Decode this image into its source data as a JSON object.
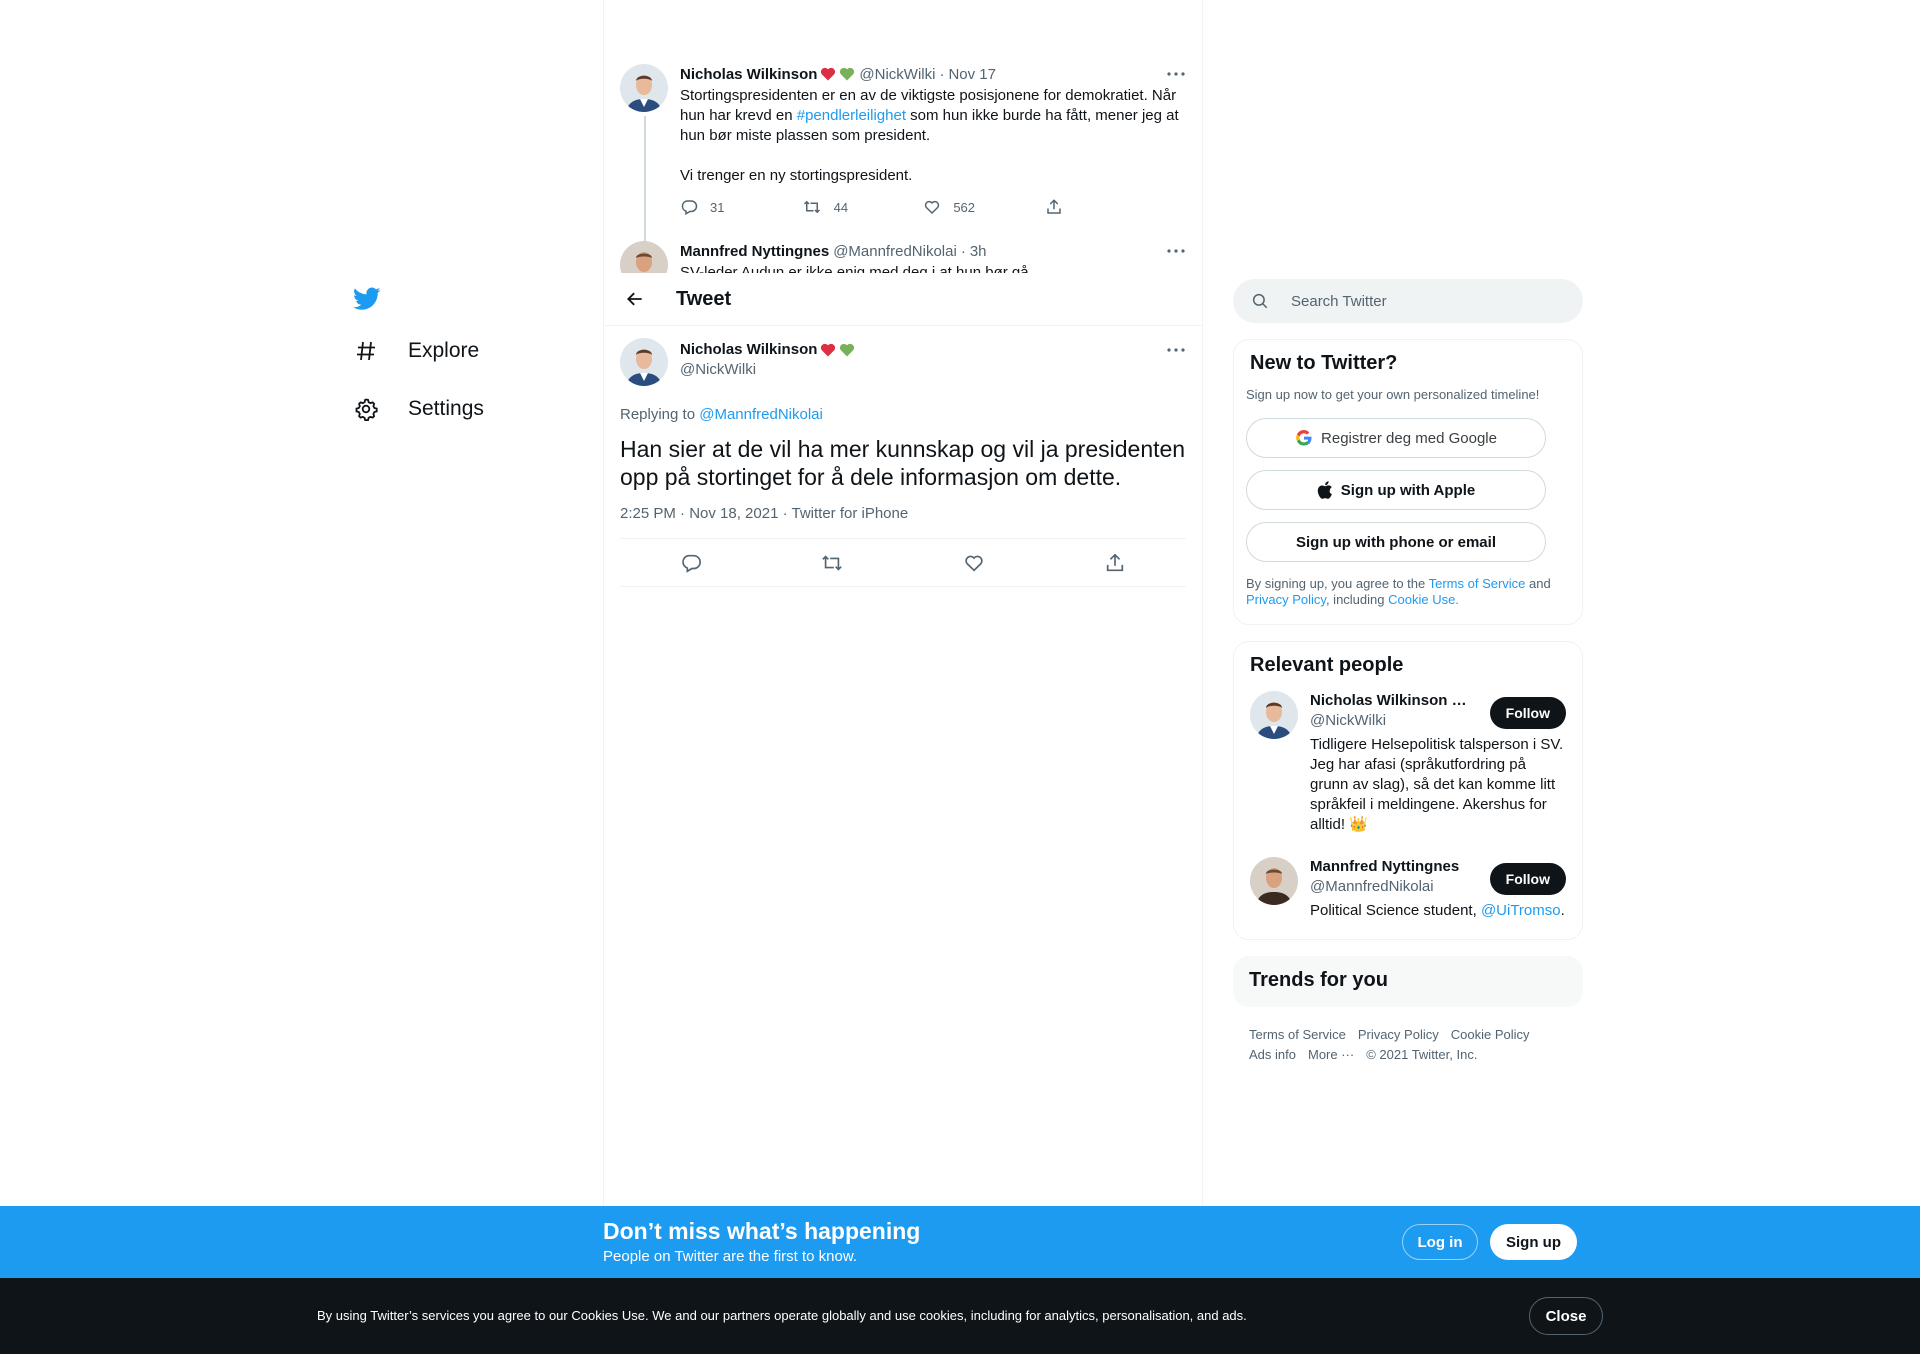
{
  "nav": {
    "items": [
      {
        "label": "Explore",
        "icon": "hashtag-icon"
      },
      {
        "label": "Settings",
        "icon": "gear-icon"
      }
    ]
  },
  "conversation": {
    "tweets": [
      {
        "name": "Nicholas Wilkinson",
        "emojis": [
          "red-heart",
          "green-heart"
        ],
        "handle": "@NickWilki",
        "sep": "·",
        "time": "Nov 17",
        "text_1": "Stortingspresidenten er en av de viktigste posisjonene for demokratiet. Når hun har krevd en ",
        "hashtag": "#pendlerleilighet",
        "text_2": " som hun ikke burde ha fått, mener jeg at hun bør miste plassen som president.",
        "text_3": "Vi trenger en ny stortingspresident.",
        "replies": "31",
        "retweets": "44",
        "likes": "562"
      },
      {
        "name": "Mannfred Nyttingnes",
        "handle": "@MannfredNikolai",
        "sep": "·",
        "time": "3h",
        "text": "SV-leder Audun er ikke enig med deg i at hun bør gå."
      }
    ]
  },
  "header": {
    "title": "Tweet"
  },
  "focal": {
    "name": "Nicholas Wilkinson",
    "handle": "@NickWilki",
    "replying_prefix": "Replying to ",
    "replying_to": "@MannfredNikolai",
    "text": "Han sier at de vil ha mer kunnskap og vil ja presidenten opp på stortinget for å dele informasjon om dette.",
    "meta": "2:25 PM · Nov 18, 2021 · Twitter for iPhone"
  },
  "search": {
    "placeholder": "Search Twitter"
  },
  "new_to_twitter": {
    "title": "New to Twitter?",
    "subtitle": "Sign up now to get your own personalized timeline!",
    "google": "Registrer deg med Google",
    "apple": "Sign up with Apple",
    "phone": "Sign up with phone or email",
    "terms_1": "By signing up, you agree to the ",
    "terms_link": "Terms of Service",
    "terms_2": " and ",
    "privacy_link": "Privacy Policy",
    "terms_3": ", including ",
    "cookie_link": "Cookie Use."
  },
  "relevant": {
    "title": "Relevant people",
    "people": [
      {
        "name": "Nicholas Wilkinson ❤️💚",
        "handle": "@NickWilki",
        "bio": "Tidligere Helsepolitisk talsperson i SV. Jeg har afasi (språkutfordring på grunn av slag), så det kan komme litt språkfeil i meldingene. Akershus for alltid! 👑",
        "follow": "Follow"
      },
      {
        "name": "Mannfred Nyttingnes",
        "handle": "@MannfredNikolai",
        "bio_1": "Political Science student, ",
        "bio_link": "@UiTromso",
        "bio_2": ".",
        "follow": "Follow"
      }
    ]
  },
  "trends": {
    "title": "Trends for you"
  },
  "footer": {
    "links": [
      "Terms of Service",
      "Privacy Policy",
      "Cookie Policy",
      "Ads info",
      "More ···",
      "© 2021 Twitter, Inc."
    ]
  },
  "banner": {
    "title": "Don’t miss what’s happening",
    "subtitle": "People on Twitter are the first to know.",
    "login": "Log in",
    "signup": "Sign up"
  },
  "cookie": {
    "text": "By using Twitter’s services you agree to our Cookies Use. We and our partners operate globally and use cookies, including for analytics, personalisation, and ads.",
    "close": "Close"
  },
  "colors": {
    "accent": "#1d9bf0",
    "text": "#0f1419",
    "secondary": "#536471",
    "border": "#eff3f4",
    "dark": "#0f1419"
  }
}
